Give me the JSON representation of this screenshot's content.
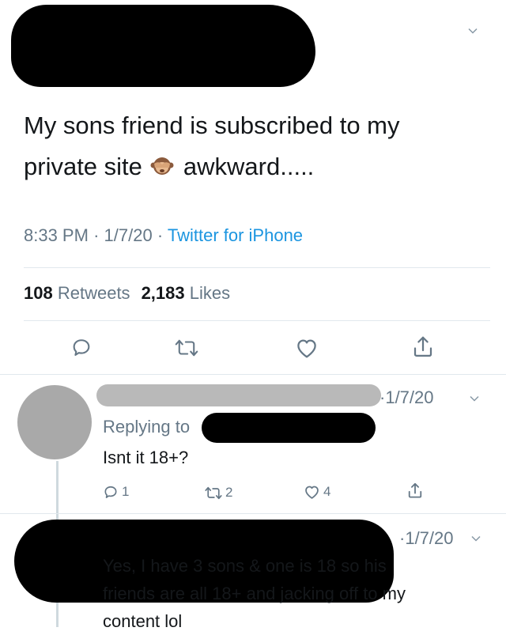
{
  "tweet": {
    "text_line1": "My sons friend is subscribed to my",
    "text_line2_a": "private site",
    "text_line2_b": "awkward.....",
    "emoji": "see-no-evil-monkey-emoji",
    "time": "8:33 PM",
    "date": "1/7/20",
    "source": "Twitter for iPhone",
    "retweets_count": "108",
    "retweets_label": "Retweets",
    "likes_count": "2,183",
    "likes_label": "Likes"
  },
  "replies": [
    {
      "date": "1/7/20",
      "replying_to": "Replying to",
      "text": "Isnt it 18+?",
      "reply_count": "1",
      "retweet_count": "2",
      "like_count": "4"
    },
    {
      "date": "1/7/20",
      "text_line1": "Yes, I have 3 sons & one is 18 so his",
      "text_line2": "friends are all 18+ and jacking off to my",
      "text_line3": "content lol"
    }
  ],
  "icons": {
    "reply": "reply-icon",
    "retweet": "retweet-icon",
    "like": "heart-icon",
    "share": "share-icon",
    "more": "chevron-down-icon"
  },
  "colors": {
    "link": "#1b95e0",
    "meta_gray": "#657786",
    "divider": "#e1e8ed"
  }
}
